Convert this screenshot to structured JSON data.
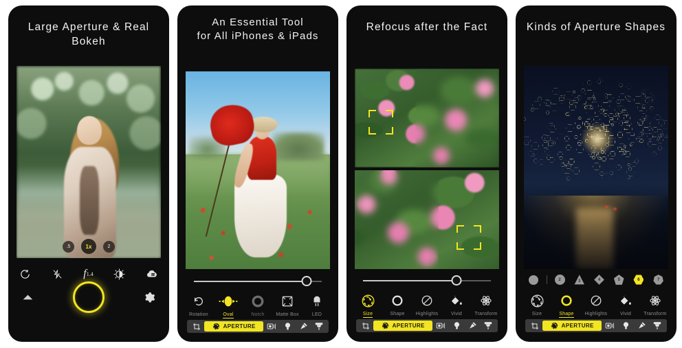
{
  "gallery": {
    "panels": [
      {
        "id": "panel-capture",
        "title": "Large Aperture & Real Bokeh",
        "photo_alt": "woman-in-forest-portrait",
        "zoom_levels": [
          {
            "label": ".5",
            "active": false
          },
          {
            "label": "1x",
            "active": true
          },
          {
            "label": "2",
            "active": false
          }
        ],
        "camera_icons": [
          {
            "name": "camera-flip-icon",
            "label": "Flip Camera"
          },
          {
            "name": "flash-off-icon",
            "label": "Flash Off"
          },
          {
            "name": "aperture-value-icon",
            "label": "f1.4"
          },
          {
            "name": "exposure-icon",
            "label": "Exposure"
          },
          {
            "name": "white-balance-icon",
            "label": "White Balance"
          }
        ],
        "aperture_value": "f",
        "aperture_subscript": "1.4",
        "bottom_controls": [
          {
            "name": "expand-arrow-icon",
            "label": "More"
          },
          {
            "name": "shutter-button",
            "label": "Shutter"
          },
          {
            "name": "settings-gear-icon",
            "label": "Settings"
          }
        ]
      },
      {
        "id": "panel-essential-tool",
        "title": "An Essential Tool\nfor All iPhones & iPads",
        "photo_alt": "girl-with-giant-poppy-in-field",
        "slider": {
          "value": 88
        },
        "tools": [
          {
            "label": "Rotation",
            "icon": "rotate-icon",
            "state": "normal"
          },
          {
            "label": "Oval",
            "icon": "oval-icon",
            "state": "active"
          },
          {
            "label": "Notch",
            "icon": "notch-icon",
            "state": "dim"
          },
          {
            "label": "Matte Box",
            "icon": "matte-box-icon",
            "state": "normal"
          },
          {
            "label": "LED",
            "icon": "led-icon",
            "state": "normal"
          }
        ],
        "tabbar": [
          {
            "label": "",
            "icon": "crop-icon",
            "selected": false
          },
          {
            "label": "APERTURE",
            "icon": "aperture-icon",
            "selected": true
          },
          {
            "label": "",
            "icon": "lens-icon",
            "selected": false
          },
          {
            "label": "",
            "icon": "light-bulb-icon",
            "selected": false
          },
          {
            "label": "",
            "icon": "magic-wand-icon",
            "selected": false
          },
          {
            "label": "",
            "icon": "brush-icon",
            "selected": false
          }
        ]
      },
      {
        "id": "panel-refocus",
        "title": "Refocus after the Fact",
        "photo_alt": "split-view-pink-flowers-focus-comparison",
        "slider": {
          "value": 73
        },
        "tools": [
          {
            "label": "Size",
            "icon": "aperture-size-icon",
            "state": "active"
          },
          {
            "label": "Shape",
            "icon": "shape-circle-icon",
            "state": "normal"
          },
          {
            "label": "Highlights",
            "icon": "highlights-icon",
            "state": "normal"
          },
          {
            "label": "Vivid",
            "icon": "vivid-paint-icon",
            "state": "normal"
          },
          {
            "label": "Transform",
            "icon": "transform-icon",
            "state": "normal"
          }
        ],
        "tabbar": [
          {
            "label": "",
            "icon": "crop-icon",
            "selected": false
          },
          {
            "label": "APERTURE",
            "icon": "aperture-icon",
            "selected": true
          },
          {
            "label": "",
            "icon": "lens-icon",
            "selected": false
          },
          {
            "label": "",
            "icon": "light-bulb-icon",
            "selected": false
          },
          {
            "label": "",
            "icon": "magic-wand-icon",
            "selected": false
          },
          {
            "label": "",
            "icon": "brush-icon",
            "selected": false
          }
        ]
      },
      {
        "id": "panel-aperture-shapes",
        "title": "Kinds of Aperture Shapes",
        "photo_alt": "night-road-with-hexagonal-bokeh-lights",
        "shapes": [
          {
            "label": "",
            "sides": 0,
            "selected": false
          },
          {
            "label": "2",
            "sides": 2,
            "selected": false
          },
          {
            "label": "3",
            "sides": 3,
            "selected": false
          },
          {
            "label": "4",
            "sides": 4,
            "selected": false
          },
          {
            "label": "5",
            "sides": 5,
            "selected": false
          },
          {
            "label": "6",
            "sides": 6,
            "selected": true
          },
          {
            "label": "7",
            "sides": 7,
            "selected": false
          }
        ],
        "tools": [
          {
            "label": "Size",
            "icon": "aperture-size-icon",
            "state": "normal"
          },
          {
            "label": "Shape",
            "icon": "shape-circle-icon",
            "state": "active"
          },
          {
            "label": "Highlights",
            "icon": "highlights-icon",
            "state": "normal"
          },
          {
            "label": "Vivid",
            "icon": "vivid-paint-icon",
            "state": "normal"
          },
          {
            "label": "Transform",
            "icon": "transform-icon",
            "state": "normal"
          }
        ],
        "tabbar": [
          {
            "label": "",
            "icon": "crop-icon",
            "selected": false
          },
          {
            "label": "APERTURE",
            "icon": "aperture-icon",
            "selected": true
          },
          {
            "label": "",
            "icon": "lens-icon",
            "selected": false
          },
          {
            "label": "",
            "icon": "light-bulb-icon",
            "selected": false
          },
          {
            "label": "",
            "icon": "magic-wand-icon",
            "selected": false
          },
          {
            "label": "",
            "icon": "brush-icon",
            "selected": false
          }
        ]
      }
    ]
  },
  "colors": {
    "accent_yellow": "#f2e521",
    "panel_bg": "#0d0d0e",
    "page_bg": "#ffffff",
    "tabbar_bg": "#3a3a3a",
    "label_gray": "#8d8d8d"
  }
}
